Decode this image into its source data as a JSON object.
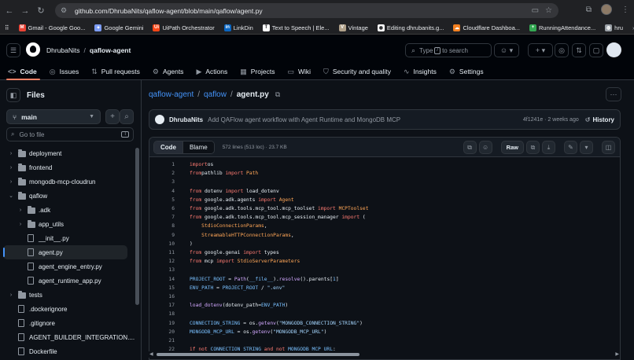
{
  "browser": {
    "url": "github.com/DhrubaNits/qaflow-agent/blob/main/qaflow/agent.py",
    "bookmarks": [
      {
        "label": "Gmail - Google Goo...",
        "color": "#ea4335",
        "glyph": "M"
      },
      {
        "label": "Google Gemini",
        "color": "#7c9cf4",
        "glyph": "✦"
      },
      {
        "label": "UiPath Orchestrator",
        "color": "#fa4616",
        "glyph": "Ui"
      },
      {
        "label": "LinkDin",
        "color": "#0a66c2",
        "glyph": "in"
      },
      {
        "label": "Text to Speech | Ele...",
        "color": "#ffffff",
        "glyph": "T"
      },
      {
        "label": "Vintage",
        "color": "#b0a18a",
        "glyph": "V"
      },
      {
        "label": "Editing dhrubanits.g...",
        "color": "#ffffff",
        "glyph": "◉"
      },
      {
        "label": "Cloudflare Dashboa...",
        "color": "#f38020",
        "glyph": "☁"
      },
      {
        "label": "RunningAttendance...",
        "color": "#34a853",
        "glyph": "+"
      },
      {
        "label": "hru",
        "color": "#9aa0a6",
        "glyph": "◍"
      }
    ]
  },
  "header": {
    "owner": "DhrubaNits",
    "repo": "qaflow-agent",
    "search_placeholder_pre": "Type",
    "search_key": "/",
    "search_placeholder_post": "to search"
  },
  "repo_tabs": [
    {
      "label": "Code",
      "icon": "code-icon",
      "glyph": "<>",
      "active": true
    },
    {
      "label": "Issues",
      "icon": "issue-icon",
      "glyph": "◎",
      "active": false
    },
    {
      "label": "Pull requests",
      "icon": "pull-request-icon",
      "glyph": "⇅",
      "active": false
    },
    {
      "label": "Agents",
      "icon": "agents-icon",
      "glyph": "⚙",
      "active": false
    },
    {
      "label": "Actions",
      "icon": "actions-icon",
      "glyph": "▶",
      "active": false
    },
    {
      "label": "Projects",
      "icon": "projects-icon",
      "glyph": "▦",
      "active": false
    },
    {
      "label": "Wiki",
      "icon": "wiki-icon",
      "glyph": "▭",
      "active": false
    },
    {
      "label": "Security and quality",
      "icon": "shield-icon",
      "glyph": "⛉",
      "active": false
    },
    {
      "label": "Insights",
      "icon": "graph-icon",
      "glyph": "∿",
      "active": false
    },
    {
      "label": "Settings",
      "icon": "gear-icon",
      "glyph": "⚙",
      "active": false
    }
  ],
  "sidebar": {
    "title": "Files",
    "branch": "main",
    "goto_placeholder": "Go to file",
    "goto_key": "T",
    "items": [
      {
        "label": "deployment",
        "type": "folder",
        "depth": 0,
        "expanded": false
      },
      {
        "label": "frontend",
        "type": "folder",
        "depth": 0,
        "expanded": false
      },
      {
        "label": "mongodb-mcp-cloudrun",
        "type": "folder",
        "depth": 0,
        "expanded": false
      },
      {
        "label": "qaflow",
        "type": "folder",
        "depth": 0,
        "expanded": true
      },
      {
        "label": ".adk",
        "type": "folder",
        "depth": 1,
        "expanded": false
      },
      {
        "label": "app_utils",
        "type": "folder",
        "depth": 1,
        "expanded": false
      },
      {
        "label": "__init__.py",
        "type": "file",
        "depth": 1
      },
      {
        "label": "agent.py",
        "type": "file",
        "depth": 1,
        "selected": true
      },
      {
        "label": "agent_engine_entry.py",
        "type": "file",
        "depth": 1
      },
      {
        "label": "agent_runtime_app.py",
        "type": "file",
        "depth": 1
      },
      {
        "label": "tests",
        "type": "folder",
        "depth": 0,
        "expanded": false
      },
      {
        "label": ".dockerignore",
        "type": "file",
        "depth": 0
      },
      {
        "label": ".gitignore",
        "type": "file",
        "depth": 0
      },
      {
        "label": "AGENT_BUILDER_INTEGRATION....",
        "type": "file",
        "depth": 0
      },
      {
        "label": "Dockerfile",
        "type": "file",
        "depth": 0
      }
    ]
  },
  "breadcrumb": {
    "repo": "qaflow-agent",
    "folder": "qaflow",
    "file": "agent.py"
  },
  "commit": {
    "author": "DhrubaNits",
    "message": "Add QAFlow agent workflow with Agent Runtime and MongoDB MCP",
    "meta": "4f1241e · 2 weeks ago",
    "history_label": "History"
  },
  "code_toolbar": {
    "code_tab": "Code",
    "blame_tab": "Blame",
    "stats": "572 lines (513 loc) · 23.7 KB",
    "raw_label": "Raw"
  },
  "code_lines": [
    [
      [
        "kw",
        "import"
      ],
      [
        "",
        "os"
      ]
    ],
    [
      [
        "kw",
        "from"
      ],
      [
        "",
        "pathlib "
      ],
      [
        "kw",
        "import"
      ],
      [
        "cl",
        " Path"
      ]
    ],
    [],
    [
      [
        "kw",
        "from"
      ],
      [
        "",
        " dotenv "
      ],
      [
        "kw",
        "import"
      ],
      [
        "",
        " load_dotenv"
      ]
    ],
    [
      [
        "kw",
        "from"
      ],
      [
        "",
        " google.adk.agents "
      ],
      [
        "kw",
        "import"
      ],
      [
        "cl",
        " Agent"
      ]
    ],
    [
      [
        "kw",
        "from"
      ],
      [
        "",
        " google.adk.tools.mcp_tool.mcp_toolset "
      ],
      [
        "kw",
        "import"
      ],
      [
        "cl",
        " MCPToolset"
      ]
    ],
    [
      [
        "kw",
        "from"
      ],
      [
        "",
        " google.adk.tools.mcp_tool.mcp_session_manager "
      ],
      [
        "kw",
        "import"
      ],
      [
        "",
        " ("
      ]
    ],
    [
      [
        "",
        "    "
      ],
      [
        "cl",
        "StdioConnectionParams"
      ],
      [
        "",
        ","
      ]
    ],
    [
      [
        "",
        "    "
      ],
      [
        "cl",
        "StreamableHTTPConnectionParams"
      ],
      [
        "",
        ","
      ]
    ],
    [
      [
        "",
        ")"
      ]
    ],
    [
      [
        "kw",
        "from"
      ],
      [
        "",
        " google.genai "
      ],
      [
        "kw",
        "import"
      ],
      [
        "",
        " types"
      ]
    ],
    [
      [
        "kw",
        "from"
      ],
      [
        "",
        " mcp "
      ],
      [
        "kw",
        "import"
      ],
      [
        "cl",
        " StdioServerParameters"
      ]
    ],
    [],
    [
      [
        "cn",
        "PROJECT_ROOT"
      ],
      [
        "",
        " = "
      ],
      [
        "fn",
        "Path"
      ],
      [
        "",
        "("
      ],
      [
        "cn",
        "__file__"
      ],
      [
        "",
        ")."
      ],
      [
        "fn",
        "resolve"
      ],
      [
        "",
        "()."
      ],
      [
        "",
        "parents"
      ],
      [
        "",
        "["
      ],
      [
        "cn",
        "1"
      ],
      [
        "",
        "]"
      ]
    ],
    [
      [
        "cn",
        "ENV_PATH"
      ],
      [
        "",
        " = "
      ],
      [
        "cn",
        "PROJECT_ROOT"
      ],
      [
        "",
        " / "
      ],
      [
        "st",
        "\".env\""
      ]
    ],
    [],
    [
      [
        "fn",
        "load_dotenv"
      ],
      [
        "",
        "(dotenv_path="
      ],
      [
        "cn",
        "ENV_PATH"
      ],
      [
        "",
        ")"
      ]
    ],
    [],
    [
      [
        "cn",
        "CONNECTION_STRING"
      ],
      [
        "",
        " = "
      ],
      [
        "",
        "os."
      ],
      [
        "fn",
        "getenv"
      ],
      [
        "",
        "("
      ],
      [
        "st",
        "\"MONGODB_CONNECTION_STRING\""
      ],
      [
        "",
        ")"
      ]
    ],
    [
      [
        "cn",
        "MONGODB_MCP_URL"
      ],
      [
        "",
        " = "
      ],
      [
        "",
        "os."
      ],
      [
        "fn",
        "getenv"
      ],
      [
        "",
        "("
      ],
      [
        "st",
        "\"MONGODB_MCP_URL\""
      ],
      [
        "",
        ")"
      ]
    ],
    [],
    [
      [
        "kw",
        "if not"
      ],
      [
        "cn",
        " CONNECTION_STRING"
      ],
      [
        "kw",
        " and not"
      ],
      [
        "cn",
        " MONGODB_MCP_URL"
      ],
      [
        "",
        ":"
      ]
    ]
  ]
}
